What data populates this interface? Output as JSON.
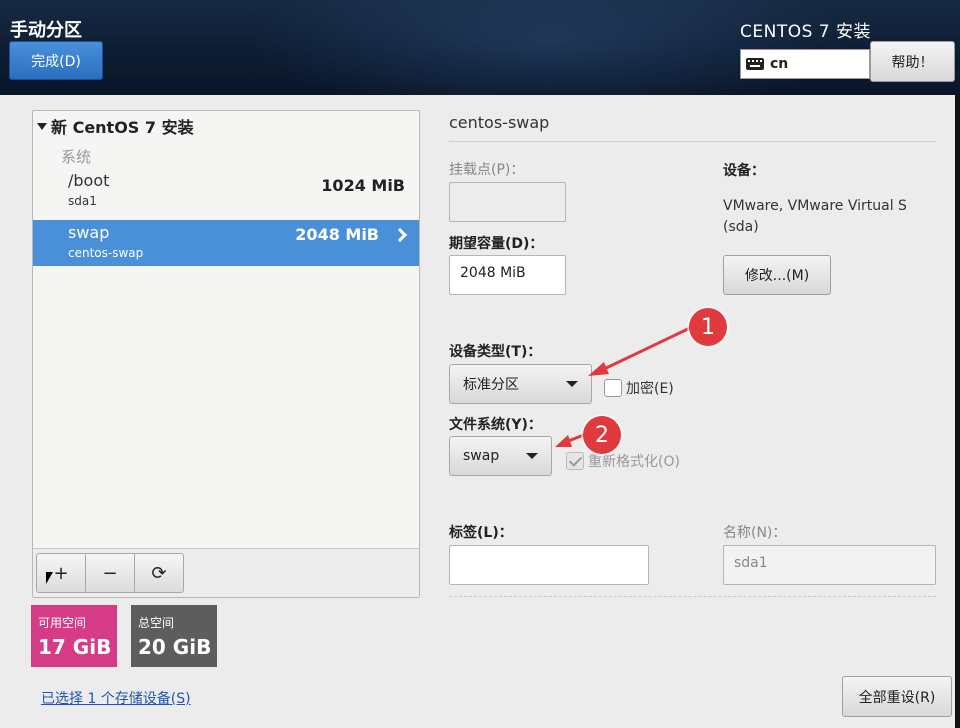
{
  "header": {
    "title": "手动分区",
    "done_label": "完成(D)",
    "product": "CENTOS 7 安装",
    "keyboard": "cn",
    "help_label": "帮助！"
  },
  "left_panel": {
    "install_title": "新 CentOS 7 安装",
    "category": "系统",
    "partitions": [
      {
        "name": "/boot",
        "device": "sda1",
        "size": "1024 MiB",
        "selected": false
      },
      {
        "name": "swap",
        "device": "centos-swap",
        "size": "2048 MiB",
        "selected": true
      }
    ],
    "toolbar": {
      "add": "+",
      "remove": "−",
      "refresh": "⟳"
    }
  },
  "space": {
    "available_label": "可用空间",
    "available_value": "17 GiB",
    "total_label": "总空间",
    "total_value": "20 GiB"
  },
  "storage_link": "已选择 1 个存储设备(S)",
  "details": {
    "title": "centos-swap",
    "mount_point_label": "挂载点(P)：",
    "mount_point_value": "",
    "desired_capacity_label": "期望容量(D)：",
    "desired_capacity_value": "2048 MiB",
    "device_label": "设备：",
    "device_desc": "VMware, VMware Virtual S (sda)",
    "modify_label": "修改...(M)",
    "device_type_label": "设备类型(T)：",
    "device_type_value": "标准分区",
    "encrypt_label": "加密(E)",
    "filesystem_label": "文件系统(Y)：",
    "filesystem_value": "swap",
    "reformat_label": "重新格式化(O)",
    "tag_label": "标签(L)：",
    "tag_value": "",
    "name_label": "名称(N)：",
    "name_value": "sda1",
    "reset_label": "全部重设(R)"
  },
  "annotations": {
    "badge1": "1",
    "badge2": "2",
    "arrow_color": "#e0393e"
  }
}
